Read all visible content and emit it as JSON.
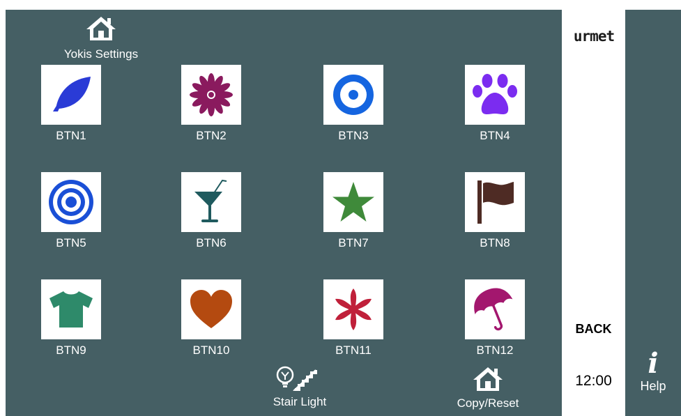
{
  "settings": {
    "label": "Yokis Settings",
    "icon": "home-icon"
  },
  "buttons": [
    {
      "label": "BTN1",
      "icon": "leaf-icon",
      "color": "#2a3bd6"
    },
    {
      "label": "BTN2",
      "icon": "flower-icon",
      "color": "#8a1a5e"
    },
    {
      "label": "BTN3",
      "icon": "ring-icon",
      "color": "#1565e0"
    },
    {
      "label": "BTN4",
      "icon": "paw-icon",
      "color": "#7b2cf0"
    },
    {
      "label": "BTN5",
      "icon": "target-icon",
      "color": "#1a4fd6"
    },
    {
      "label": "BTN6",
      "icon": "cocktail-icon",
      "color": "#1f5a5e"
    },
    {
      "label": "BTN7",
      "icon": "star-icon",
      "color": "#3f8a3a"
    },
    {
      "label": "BTN8",
      "icon": "flag-icon",
      "color": "#4e2b24"
    },
    {
      "label": "BTN9",
      "icon": "tshirt-icon",
      "color": "#2e8a6a"
    },
    {
      "label": "BTN10",
      "icon": "heart-icon",
      "color": "#b44a10"
    },
    {
      "label": "BTN11",
      "icon": "asterisk-icon",
      "color": "#c0203a"
    },
    {
      "label": "BTN12",
      "icon": "umbrella-icon",
      "color": "#a3176e"
    }
  ],
  "stair_light": {
    "label": "Stair Light",
    "icon": "stair-light-icon"
  },
  "copy_reset": {
    "label": "Copy/Reset",
    "icon": "home-icon"
  },
  "brand": "urmet",
  "back": "BACK",
  "clock": "12:00",
  "help": {
    "label": "Help",
    "glyph": "i",
    "icon": "info-icon"
  },
  "colors": {
    "panel": "#455f64",
    "side": "#ffffff",
    "text": "#ffffff"
  }
}
